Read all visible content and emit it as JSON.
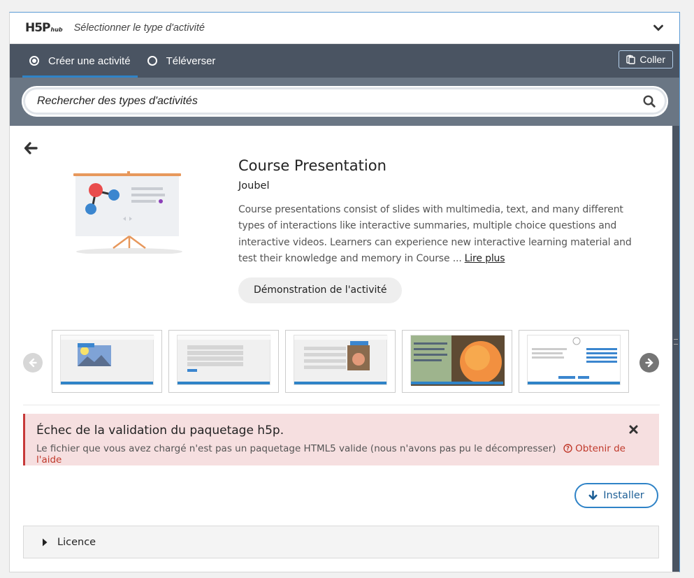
{
  "header": {
    "logo_main": "H5P",
    "logo_sub": "hub",
    "title": "Sélectionner le type d'activité"
  },
  "tabs": [
    {
      "label": "Créer une activité",
      "active": true
    },
    {
      "label": "Téléverser",
      "active": false
    }
  ],
  "paste_label": "Coller",
  "search": {
    "placeholder": "Rechercher des types d'activités"
  },
  "detail": {
    "title": "Course Presentation",
    "owner": "Joubel",
    "description": "Course presentations consist of slides with multimedia, text, and many different types of interactions like interactive summaries, multiple choice questions and interactive videos. Learners can experience new interactive learning material and test their knowledge and memory in Course ...",
    "read_more": "Lire plus",
    "demo_label": "Démonstration de l'activité"
  },
  "alert": {
    "title": "Échec de la validation du paquetage h5p.",
    "message": "Le fichier que vous avez chargé n'est pas un paquetage HTML5 valide (nous n'avons pas pu le décompresser)",
    "help": "Obtenir de l'aide"
  },
  "install_label": "Installer",
  "licence_label": "Licence",
  "colors": {
    "accent": "#2f83c7",
    "tabbar": "#4a5462",
    "searchbar": "#6a7684",
    "alert_bg": "#f6dfe0",
    "alert_text": "#c0392b"
  },
  "icons": [
    "chevron-down-icon",
    "radio-icon",
    "paste-icon",
    "search-icon",
    "back-arrow-icon",
    "prev-icon",
    "next-icon",
    "close-icon",
    "help-icon",
    "download-icon",
    "caret-right-icon"
  ]
}
